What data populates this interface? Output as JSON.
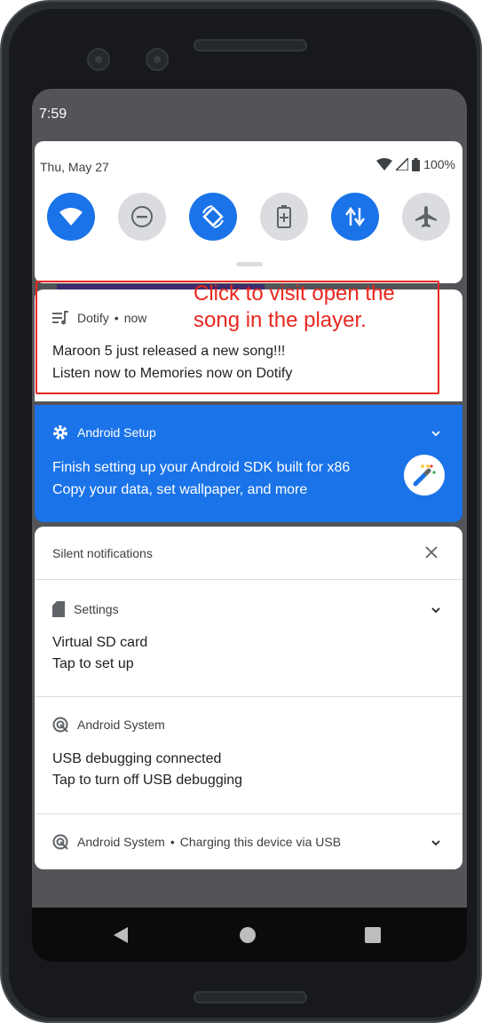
{
  "status_bar": {
    "time": "7:59"
  },
  "quick_settings": {
    "date": "Thu, May 27",
    "battery": "100%",
    "tiles": [
      {
        "name": "wifi",
        "state": "on"
      },
      {
        "name": "do-not-disturb",
        "state": "off"
      },
      {
        "name": "auto-rotate",
        "state": "on"
      },
      {
        "name": "battery-saver",
        "state": "off"
      },
      {
        "name": "mobile-data",
        "state": "on"
      },
      {
        "name": "airplane-mode",
        "state": "off"
      }
    ]
  },
  "dotify_notification": {
    "app": "Dotify",
    "separator": "•",
    "time": "now",
    "title": "Maroon 5 just released a new song!!!",
    "text": "Listen now to Memories now on Dotify"
  },
  "annotation": {
    "text": "Click to visit open the song in the player.",
    "color": "#e8281f"
  },
  "setup_notification": {
    "app": "Android Setup",
    "title": "Finish setting up your Android SDK built for x86",
    "text": "Copy your data, set wallpaper, and more",
    "color": "#1a73e8"
  },
  "silent": {
    "header": "Silent notifications",
    "items": [
      {
        "app": "Settings",
        "title": "Virtual SD card",
        "text": "Tap to set up"
      },
      {
        "app": "Android System",
        "title": "USB debugging connected",
        "text": "Tap to turn off USB debugging"
      },
      {
        "app": "Android System",
        "summary": "Charging this device via USB"
      }
    ]
  },
  "colors": {
    "accent": "#1a73e8",
    "tile_off": "#dadce0",
    "frame": "#2a2d31"
  }
}
